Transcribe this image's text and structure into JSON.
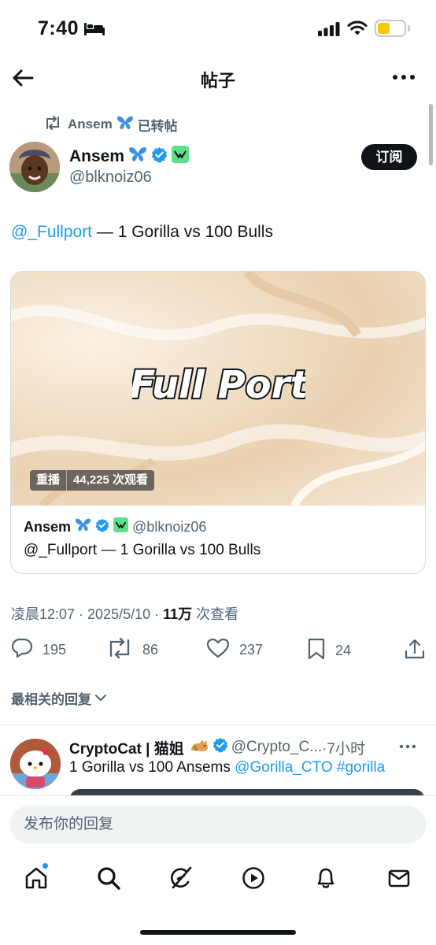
{
  "status_bar": {
    "time": "7:40"
  },
  "header": {
    "title": "帖子"
  },
  "repost_banner": {
    "name": "Ansem",
    "suffix": "已转帖"
  },
  "post": {
    "author_name": "Ansem",
    "handle": "@blknoiz06",
    "subscribe_label": "订阅",
    "mention": "@_Fullport",
    "text": " — 1 Gorilla vs 100 Bulls",
    "timestamp": "凌晨12:07 · 2025/5/10 · ",
    "views_count": "11万",
    "views_suffix": " 次查看"
  },
  "card": {
    "media_title": "Full Port",
    "replay_label": "重播",
    "views_label": "44,225 次观看",
    "author_name": "Ansem",
    "handle": "@blknoiz06",
    "text": "@_Fullport — 1 Gorilla vs 100 Bulls"
  },
  "actions": {
    "replies": "195",
    "reposts": "86",
    "likes": "237",
    "bookmarks": "24"
  },
  "sort": {
    "label": "最相关的回复"
  },
  "reply": {
    "author_name": "CryptoCat | 猫姐",
    "handle": "@Crypto_C...",
    "time": "·7小时",
    "text_prefix": "1 Gorilla vs 100 Ansems ",
    "mention": "@Gorilla_CTO",
    "hashtag": "#gorilla"
  },
  "composer": {
    "placeholder": "发布你的回复"
  },
  "colors": {
    "accent": "#1d9bf0",
    "text_primary": "#0f1419",
    "text_secondary": "#536471",
    "verified_badge": "#1d9bf0",
    "affiliate_badge": "#5ce08b",
    "battery_fill": "#f5c800"
  },
  "icons": {
    "status": [
      "bed-icon",
      "signal-icon",
      "wifi-icon",
      "battery-icon"
    ],
    "header": [
      "back-arrow-icon",
      "more-icon"
    ],
    "actions": [
      "reply-icon",
      "repost-icon",
      "like-icon",
      "bookmark-icon",
      "share-icon"
    ],
    "tabs": [
      "home-icon",
      "search-icon",
      "grok-icon",
      "video-icon",
      "notifications-icon",
      "messages-icon"
    ]
  }
}
